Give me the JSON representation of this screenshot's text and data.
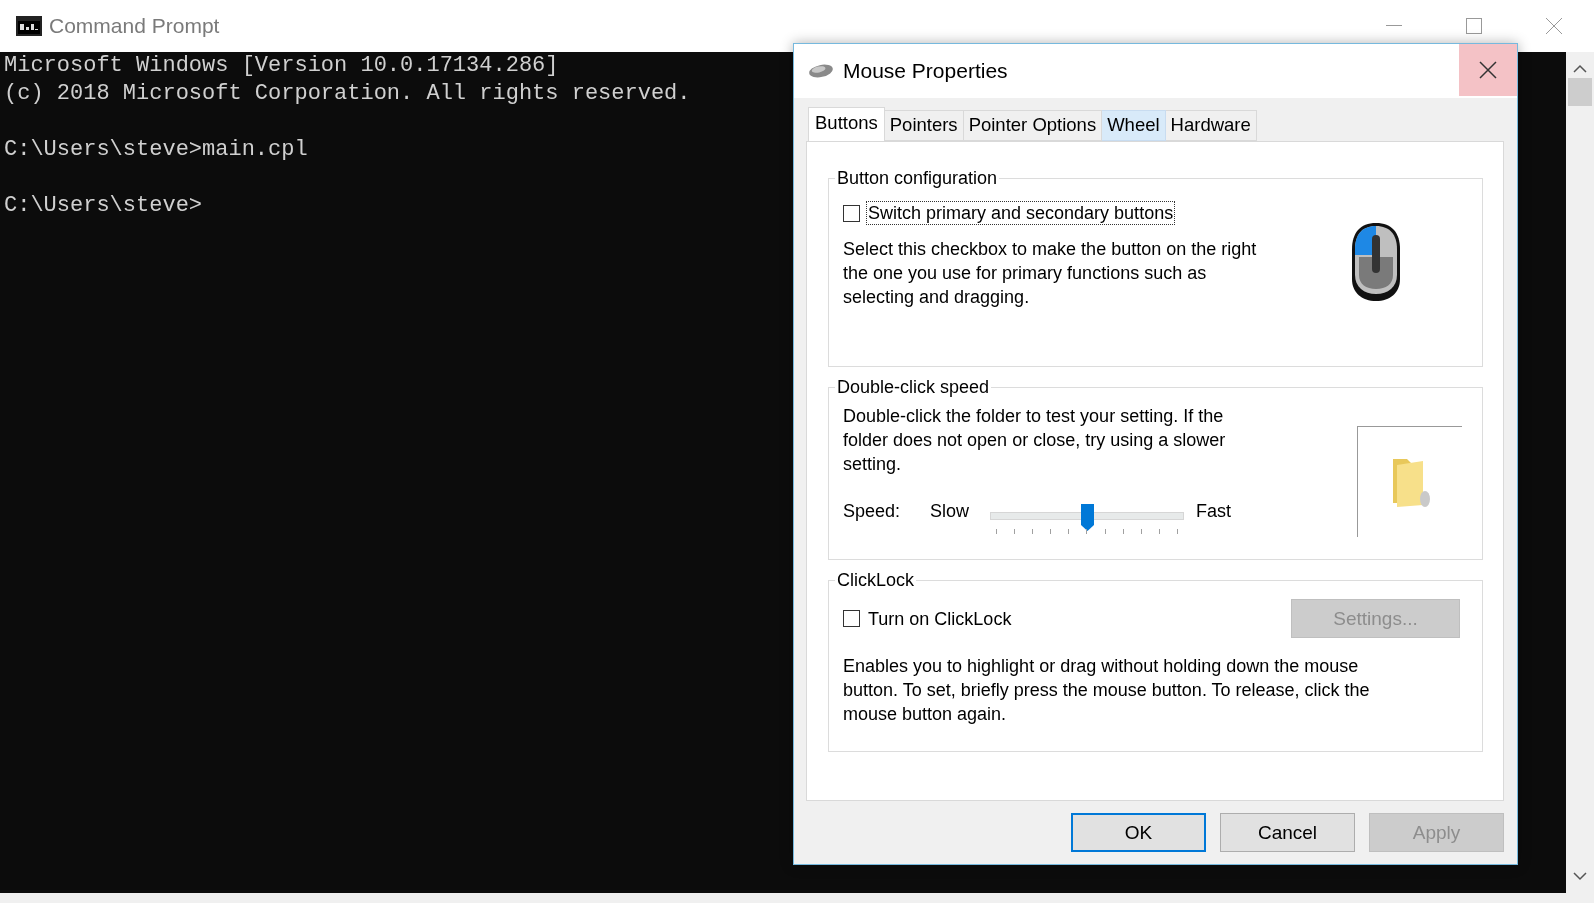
{
  "console": {
    "title": "Command Prompt",
    "blocks": [
      [
        "Microsoft Windows [Version 10.0.17134.286]",
        "(c) 2018 Microsoft Corporation. All rights reserved."
      ],
      [
        "C:\\Users\\steve>main.cpl"
      ],
      [
        "C:\\Users\\steve>"
      ]
    ]
  },
  "dialog": {
    "title": "Mouse Properties",
    "tabs": [
      {
        "label": "Buttons",
        "selected": true,
        "hovered": false
      },
      {
        "label": "Pointers",
        "selected": false,
        "hovered": false
      },
      {
        "label": "Pointer Options",
        "selected": false,
        "hovered": false
      },
      {
        "label": "Wheel",
        "selected": false,
        "hovered": true
      },
      {
        "label": "Hardware",
        "selected": false,
        "hovered": false
      }
    ],
    "button_configuration": {
      "title": "Button configuration",
      "checkbox": {
        "label": "Switch primary and secondary buttons",
        "checked": false,
        "focused": true
      },
      "description": "Select this checkbox to make the button on the right the one you use for primary functions such as selecting and dragging."
    },
    "double_click_speed": {
      "title": "Double-click speed",
      "description": "Double-click the folder to test your setting. If the folder does not open or close, try using a slower setting.",
      "speed_label": "Speed:",
      "slow_label": "Slow",
      "fast_label": "Fast",
      "slider": {
        "level": 0.5
      }
    },
    "clicklock": {
      "title": "ClickLock",
      "checkbox": {
        "label": "Turn on ClickLock",
        "checked": false,
        "focused": false
      },
      "settings_button": {
        "label": "Settings...",
        "disabled": true
      },
      "description": "Enables you to highlight or drag without holding down the mouse button. To set, briefly press the mouse button. To release, click the mouse button again."
    },
    "buttons": [
      {
        "label": "OK",
        "default": true,
        "disabled": false
      },
      {
        "label": "Cancel",
        "default": false,
        "disabled": false
      },
      {
        "label": "Apply",
        "default": false,
        "disabled": true
      }
    ]
  }
}
